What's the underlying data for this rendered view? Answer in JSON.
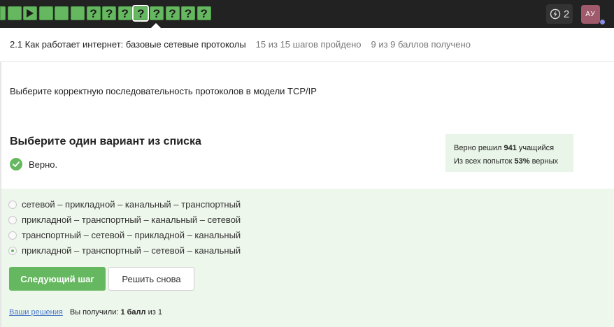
{
  "steps": [
    {
      "kind": "blank",
      "label": ""
    },
    {
      "kind": "blank",
      "label": ""
    },
    {
      "kind": "video",
      "label": ""
    },
    {
      "kind": "blank",
      "label": ""
    },
    {
      "kind": "blank",
      "label": ""
    },
    {
      "kind": "blank",
      "label": ""
    },
    {
      "kind": "quiz",
      "label": "?"
    },
    {
      "kind": "quiz",
      "label": "?"
    },
    {
      "kind": "quiz",
      "label": "?"
    },
    {
      "kind": "quiz",
      "label": "?",
      "current": true
    },
    {
      "kind": "quiz",
      "label": "?"
    },
    {
      "kind": "quiz",
      "label": "?"
    },
    {
      "kind": "quiz",
      "label": "?"
    },
    {
      "kind": "quiz",
      "label": "?"
    }
  ],
  "header": {
    "xp_count": "2",
    "avatar_initials": "АУ"
  },
  "breadcrumb": {
    "lesson": "2.1 Как работает интернет: базовые сетевые протоколы",
    "steps_progress": "15 из 15 шагов пройдено",
    "points": "9 из 9 баллов  получено"
  },
  "question": "Выберите корректную последовательность протоколов в модели TCP/IP",
  "choose_title": "Выберите один вариант из списка",
  "verdict": "Верно.",
  "stats": {
    "line1_prefix": "Верно решил ",
    "line1_value": "941",
    "line1_suffix": " учащийся",
    "line2_prefix": "Из всех попыток ",
    "line2_value": "53%",
    "line2_suffix": " верных"
  },
  "options": [
    {
      "label": "сетевой – прикладной – канальный – транспортный",
      "selected": false
    },
    {
      "label": "прикладной – транспортный – канальный – сетевой",
      "selected": false
    },
    {
      "label": "транспортный – сетевой – прикладной – канальный",
      "selected": false
    },
    {
      "label": "прикладной – транспортный – сетевой – канальный",
      "selected": true
    }
  ],
  "buttons": {
    "next": "Следующий шаг",
    "retry": "Решить снова"
  },
  "footer": {
    "solutions_link": "Ваши решения",
    "result_prefix": "Вы получили: ",
    "result_value": "1 балл",
    "result_suffix": " из 1"
  },
  "colors": {
    "accent_green": "#66b860",
    "topbar": "#222222",
    "options_bg": "#eef7ec",
    "link": "#4a78c8"
  }
}
